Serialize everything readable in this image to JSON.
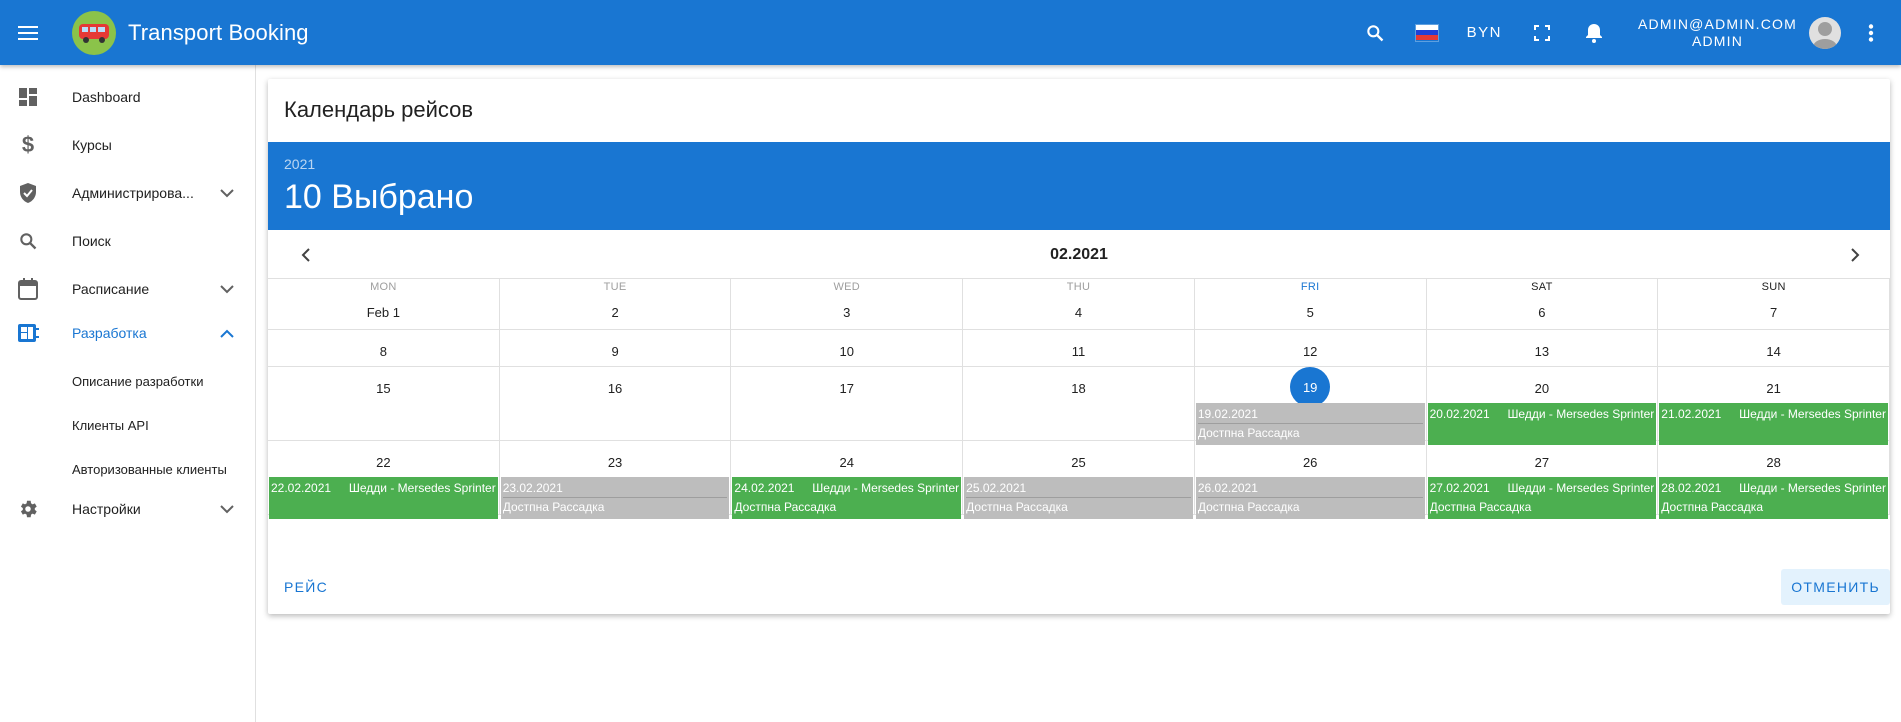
{
  "header": {
    "title": "Transport Booking",
    "currency": "BYN",
    "user_email": "ADMIN@ADMIN.COM",
    "user_role": "ADMIN",
    "accent": "#1976d2"
  },
  "sidebar": {
    "items": [
      {
        "label": "Dashboard",
        "icon": "dashboard-icon"
      },
      {
        "label": "Курсы",
        "icon": "dollar-icon"
      },
      {
        "label": "Администрирова...",
        "icon": "shield-icon"
      },
      {
        "label": "Поиск",
        "icon": "search-icon"
      },
      {
        "label": "Расписание",
        "icon": "calendar-icon"
      },
      {
        "label": "Разработка",
        "icon": "developer-board-icon"
      },
      {
        "label": "Настройки",
        "icon": "gear-icon"
      }
    ],
    "sub_items": [
      "Описание разработки",
      "Клиенты API",
      "Авторизованные клиенты"
    ]
  },
  "calendar": {
    "title": "Календарь рейсов",
    "year": "2021",
    "selected_text": "10 Выбрано",
    "month_label": "02.2021",
    "weekdays": [
      "MON",
      "TUE",
      "WED",
      "THU",
      "FRI",
      "SAT",
      "SUN"
    ],
    "weeks": [
      [
        "Feb 1",
        "2",
        "3",
        "4",
        "5",
        "6",
        "7"
      ],
      [
        "8",
        "9",
        "10",
        "11",
        "12",
        "13",
        "14"
      ],
      [
        "15",
        "16",
        "17",
        "18",
        "19",
        "20",
        "21"
      ],
      [
        "22",
        "23",
        "24",
        "25",
        "26",
        "27",
        "28"
      ]
    ],
    "events": {
      "w2d4": {
        "date": "19.02.2021",
        "title": "",
        "seat": "Достпна Рассадка",
        "color": "gray"
      },
      "w2d5": {
        "date": "20.02.2021",
        "title": "Шедди - Mersedes Sprinter",
        "seat": "",
        "color": "green"
      },
      "w2d6": {
        "date": "21.02.2021",
        "title": "Шедди - Mersedes Sprinter",
        "seat": "",
        "color": "green"
      },
      "w3d0": {
        "date": "22.02.2021",
        "title": "Шедди - Mersedes Sprinter",
        "seat": "",
        "color": "green"
      },
      "w3d1": {
        "date": "23.02.2021",
        "title": "",
        "seat": "Достпна Рассадка",
        "color": "gray"
      },
      "w3d2": {
        "date": "24.02.2021",
        "title": "Шедди - Mersedes Sprinter",
        "seat": "Достпна Рассадка",
        "color": "green"
      },
      "w3d3": {
        "date": "25.02.2021",
        "title": "",
        "seat": "Достпна Рассадка",
        "color": "gray"
      },
      "w3d4": {
        "date": "26.02.2021",
        "title": "",
        "seat": "Достпна Рассадка",
        "color": "gray"
      },
      "w3d5": {
        "date": "27.02.2021",
        "title": "Шедди - Mersedes Sprinter",
        "seat": "Достпна Рассадка",
        "color": "green"
      },
      "w3d6": {
        "date": "28.02.2021",
        "title": "Шедди - Mersedes Sprinter",
        "seat": "Достпна Рассадка",
        "color": "green"
      }
    },
    "event_colors": {
      "green": "#4caf50",
      "gray": "#bdbdbd"
    },
    "actions": {
      "left": "Рейс",
      "right": "Отменить"
    }
  }
}
